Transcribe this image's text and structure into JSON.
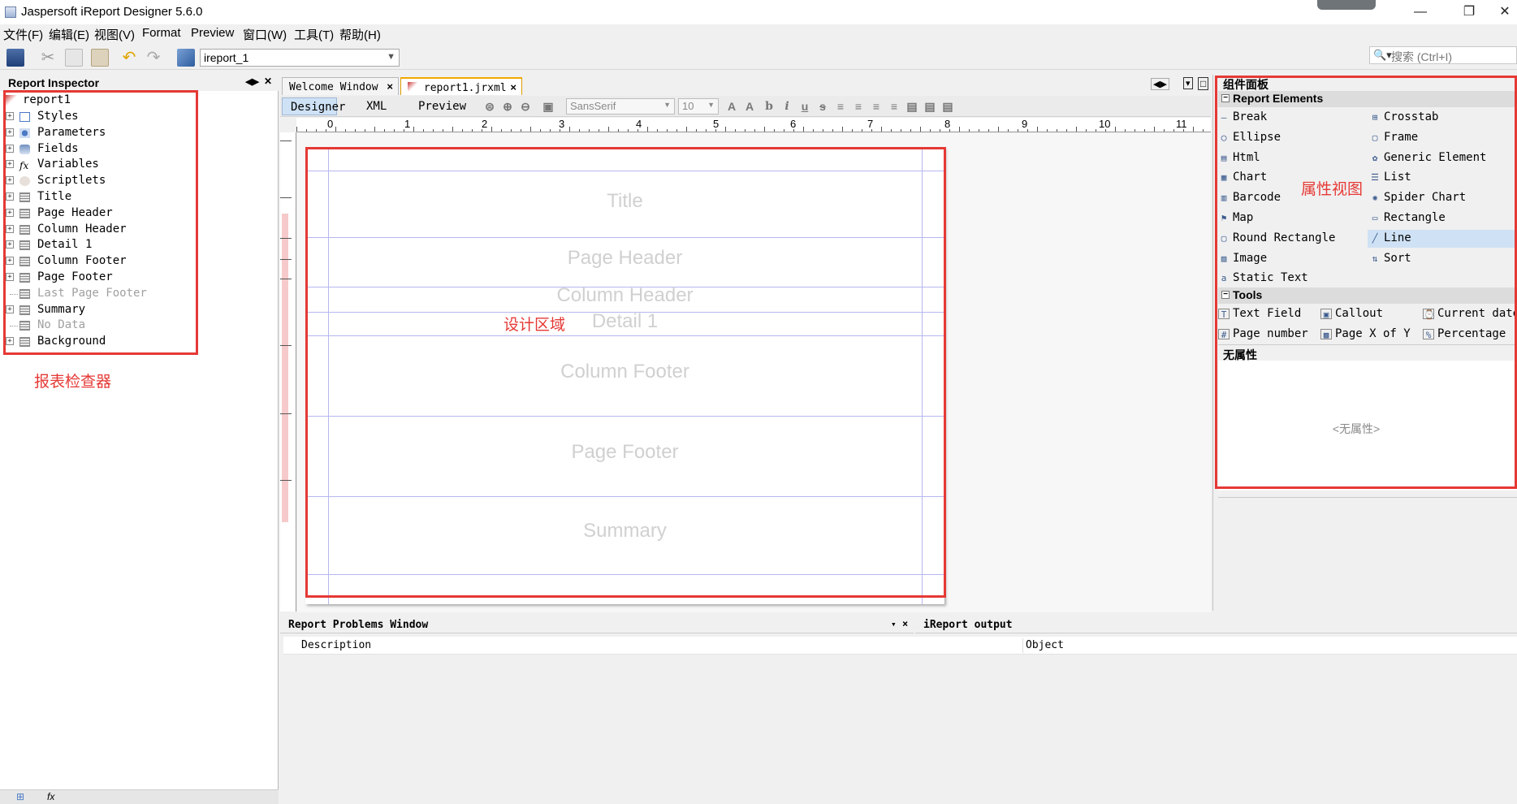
{
  "window": {
    "title": "Jaspersoft iReport Designer 5.6.0",
    "minimize": "—",
    "restore": "❐",
    "close": "✕"
  },
  "menu": [
    "文件(F)",
    "编辑(E)",
    "视图(V)",
    "Format",
    "Preview",
    "窗口(W)",
    "工具(T)",
    "帮助(H)"
  ],
  "toolbar": {
    "project": "ireport_1",
    "search_placeholder": "搜索 (Ctrl+I)"
  },
  "inspector": {
    "title": "Report Inspector",
    "root": "report1",
    "items": [
      {
        "label": "Styles",
        "icon": "styles-icon",
        "exp": true,
        "dim": false
      },
      {
        "label": "Parameters",
        "icon": "parameters-icon",
        "exp": true,
        "dim": false
      },
      {
        "label": "Fields",
        "icon": "fields-icon",
        "exp": true,
        "dim": false
      },
      {
        "label": "Variables",
        "icon": "variables-icon",
        "exp": true,
        "dim": false
      },
      {
        "label": "Scriptlets",
        "icon": "scriptlets-icon",
        "exp": true,
        "dim": false
      },
      {
        "label": "Title",
        "icon": "band-icon",
        "exp": true,
        "dim": false
      },
      {
        "label": "Page Header",
        "icon": "band-icon",
        "exp": true,
        "dim": false
      },
      {
        "label": "Column Header",
        "icon": "band-icon",
        "exp": true,
        "dim": false
      },
      {
        "label": "Detail 1",
        "icon": "band-icon",
        "exp": true,
        "dim": false
      },
      {
        "label": "Column Footer",
        "icon": "band-icon",
        "exp": true,
        "dim": false
      },
      {
        "label": "Page Footer",
        "icon": "band-icon",
        "exp": true,
        "dim": false
      },
      {
        "label": "Last Page Footer",
        "icon": "band-icon",
        "exp": false,
        "dim": true
      },
      {
        "label": "Summary",
        "icon": "band-icon",
        "exp": true,
        "dim": false
      },
      {
        "label": "No Data",
        "icon": "band-icon",
        "exp": false,
        "dim": true
      },
      {
        "label": "Background",
        "icon": "band-icon",
        "exp": true,
        "dim": false
      }
    ]
  },
  "editor": {
    "tabs": [
      {
        "label": "Welcome Window",
        "active": false
      },
      {
        "label": "report1.jrxml",
        "active": true
      }
    ],
    "views": [
      "Designer",
      "XML",
      "Preview"
    ],
    "font_name": "SansSerif",
    "font_size": "10",
    "ruler_marks": [
      "0",
      "1",
      "2",
      "3",
      "4",
      "5",
      "6",
      "7",
      "8",
      "9",
      "10",
      "11"
    ],
    "bands": [
      "Title",
      "Page Header",
      "Column Header",
      "Detail 1",
      "Column Footer",
      "Page Footer",
      "Summary"
    ]
  },
  "palette": {
    "title": "组件面板",
    "report_elements_title": "Report Elements",
    "report_elements": [
      [
        "Break",
        "Crosstab"
      ],
      [
        "Ellipse",
        "Frame"
      ],
      [
        "Html",
        "Generic Element"
      ],
      [
        "Chart",
        "List"
      ],
      [
        "Barcode",
        "Spider Chart"
      ],
      [
        "Map",
        "Rectangle"
      ],
      [
        "Round Rectangle",
        "Line"
      ],
      [
        "Image",
        "Sort"
      ],
      [
        "Static Text",
        ""
      ]
    ],
    "selected": "Line",
    "tools_title": "Tools",
    "tools": [
      [
        "Text Field",
        "Callout",
        "Current date"
      ],
      [
        "Page number",
        "Page X of Y",
        "Percentage"
      ]
    ]
  },
  "properties": {
    "title": "无属性",
    "empty": "<无属性>"
  },
  "bottom": {
    "problems_title": "Report Problems Window",
    "output_title": "iReport output",
    "columns": [
      "Description",
      "Object"
    ]
  },
  "annotations": {
    "inspector": "报表检查器",
    "design_area": "设计区域",
    "property_view": "属性视图",
    "color": "#e53935"
  }
}
